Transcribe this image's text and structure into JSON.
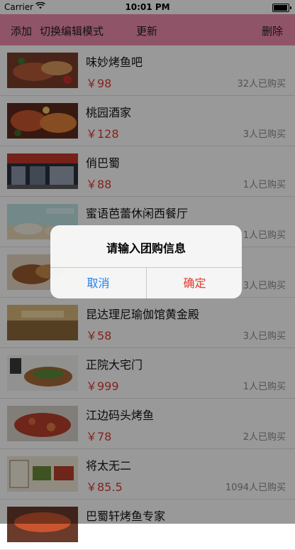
{
  "status_bar": {
    "carrier": "Carrier",
    "time": "10:01 PM"
  },
  "toolbar": {
    "add": "添加",
    "toggle_edit": "切换编辑模式",
    "refresh": "更新",
    "delete": "删除"
  },
  "deals": [
    {
      "name": "味妙烤鱼吧",
      "price": "￥98",
      "sold": "32人已购买"
    },
    {
      "name": "桃园酒家",
      "price": "￥128",
      "sold": "3人已购买"
    },
    {
      "name": "俏巴蜀",
      "price": "￥88",
      "sold": "1人已购买"
    },
    {
      "name": "蜜语芭蕾休闲西餐厅",
      "price": "",
      "sold": "1人已购买"
    },
    {
      "name": "",
      "price": "",
      "sold": "3人已购买"
    },
    {
      "name": "昆达理尼瑜伽馆黄金殿",
      "price": "￥58",
      "sold": "3人已购买"
    },
    {
      "name": "正院大宅门",
      "price": "￥999",
      "sold": "1人已购买"
    },
    {
      "name": "江边码头烤鱼",
      "price": "￥78",
      "sold": "2人已购买"
    },
    {
      "name": "将太无二",
      "price": "￥85.5",
      "sold": "1094人已购买"
    },
    {
      "name": "巴蜀轩烤鱼专家",
      "price": "",
      "sold": ""
    }
  ],
  "alert": {
    "title": "请输入团购信息",
    "cancel": "取消",
    "confirm": "确定"
  }
}
